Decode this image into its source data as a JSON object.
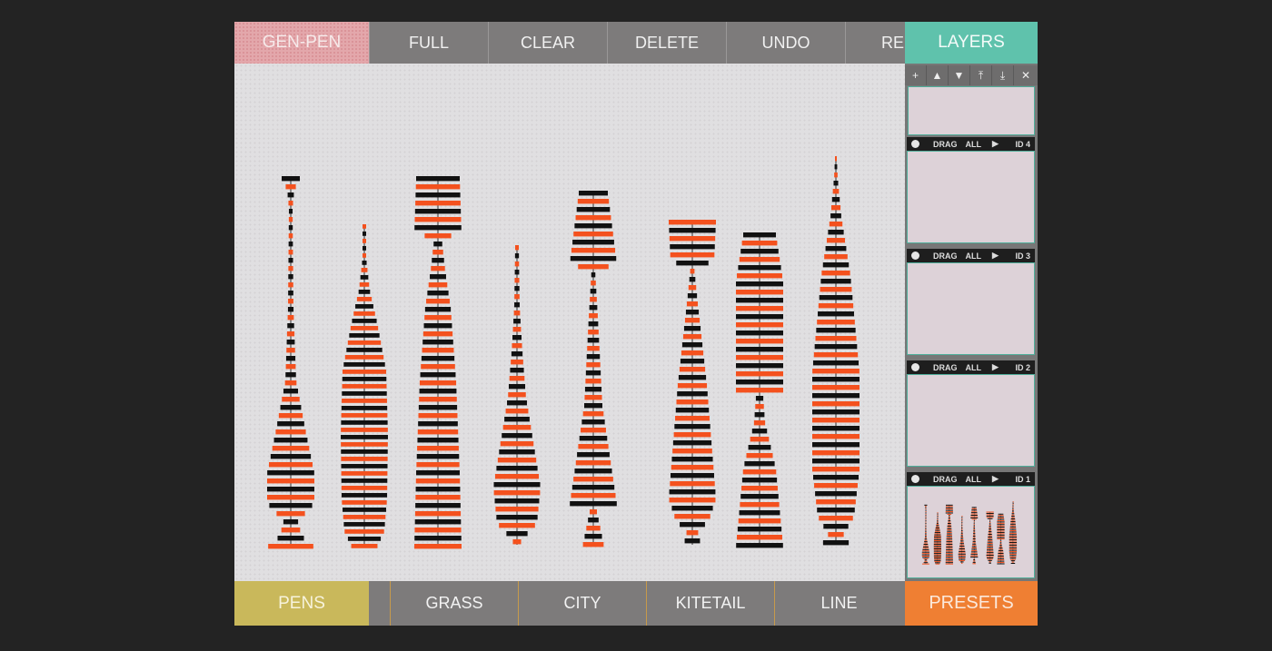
{
  "toolbar": {
    "brand": "GEN-PEN",
    "buttons": [
      "FULL",
      "CLEAR",
      "DELETE",
      "UNDO",
      "REI"
    ]
  },
  "bottombar": {
    "active": "PENS",
    "buttons": [
      "GRASS",
      "CITY",
      "KITETAIL",
      "LINE"
    ]
  },
  "layers": {
    "title": "LAYERS",
    "tools": [
      "+",
      "▲",
      "▼",
      "⤒",
      "⤓",
      "✕"
    ],
    "items": [
      {
        "drag": "DRAG",
        "all": "ALL",
        "play": "▶",
        "id": "ID 4"
      },
      {
        "drag": "DRAG",
        "all": "ALL",
        "play": "▶",
        "id": "ID 3"
      },
      {
        "drag": "DRAG",
        "all": "ALL",
        "play": "▶",
        "id": "ID 2"
      },
      {
        "drag": "DRAG",
        "all": "ALL",
        "play": "▶",
        "id": "ID 1"
      }
    ],
    "presets": "PRESETS"
  },
  "colors": {
    "stripe_orange": "#f4511e",
    "stripe_black": "#111111",
    "accent_teal": "#5fc2ac",
    "accent_pink": "#e3a7ab",
    "accent_yellow": "#c9b85b",
    "accent_orange": "#ef7f33"
  },
  "icons": {
    "add": "plus-icon",
    "up": "arrow-up-icon",
    "down": "arrow-down-icon",
    "top": "move-top-icon",
    "bottom": "move-bottom-icon",
    "close": "close-icon",
    "visibility": "circle-toggle-icon",
    "play": "play-icon"
  }
}
